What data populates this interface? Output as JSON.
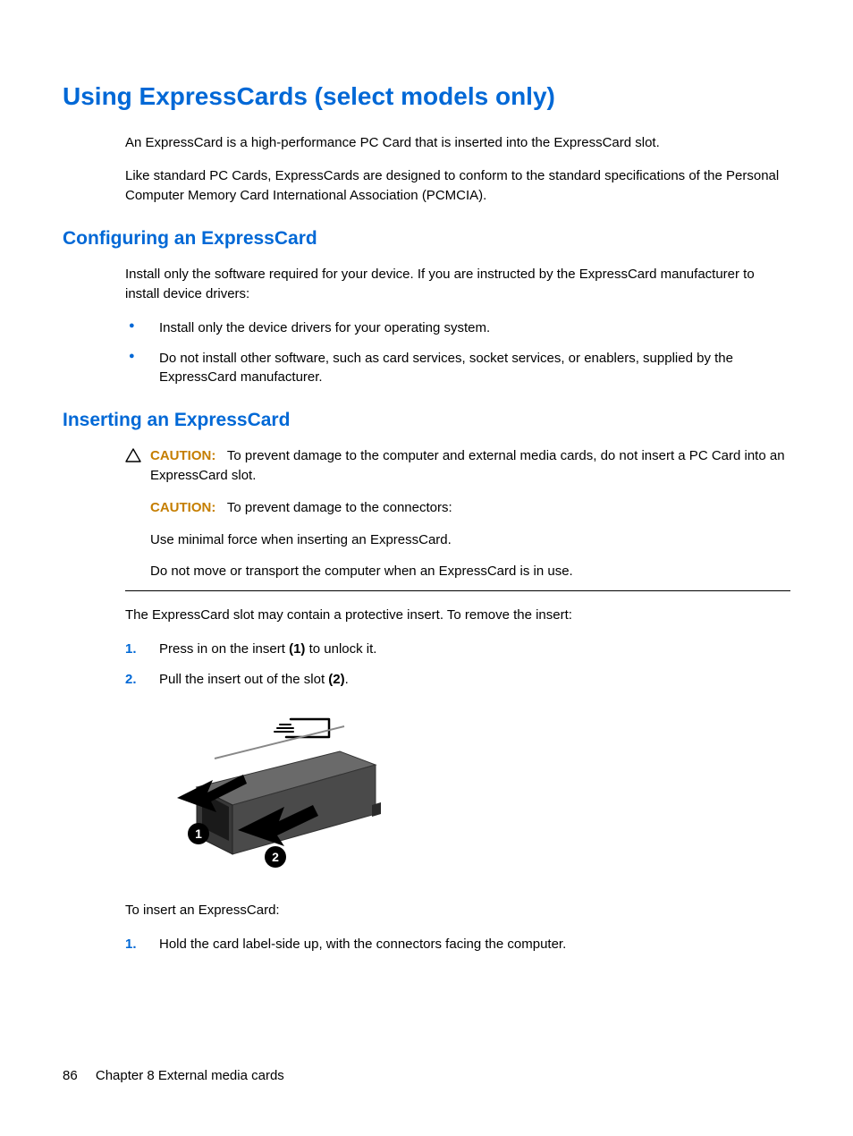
{
  "title": "Using ExpressCards (select models only)",
  "intro": {
    "p1": "An ExpressCard is a high-performance PC Card that is inserted into the ExpressCard slot.",
    "p2": "Like standard PC Cards, ExpressCards are designed to conform to the standard specifications of the Personal Computer Memory Card International Association (PCMCIA)."
  },
  "section1": {
    "heading": "Configuring an ExpressCard",
    "p1": "Install only the software required for your device. If you are instructed by the ExpressCard manufacturer to install device drivers:",
    "bullets": [
      "Install only the device drivers for your operating system.",
      "Do not install other software, such as card services, socket services, or enablers, supplied by the ExpressCard manufacturer."
    ]
  },
  "section2": {
    "heading": "Inserting an ExpressCard",
    "caution": {
      "label": "CAUTION:",
      "c1_text": "To prevent damage to the computer and external media cards, do not insert a PC Card into an ExpressCard slot.",
      "c2_text": "To prevent damage to the connectors:",
      "c3": "Use minimal force when inserting an ExpressCard.",
      "c4": "Do not move or transport the computer when an ExpressCard is in use."
    },
    "p_after_caution": "The ExpressCard slot may contain a protective insert. To remove the insert:",
    "steps_remove": [
      {
        "num": "1.",
        "pre": "Press in on the insert ",
        "bold": "(1)",
        "post": " to unlock it."
      },
      {
        "num": "2.",
        "pre": "Pull the insert out of the slot ",
        "bold": "(2)",
        "post": "."
      }
    ],
    "p_insert_intro": "To insert an ExpressCard:",
    "steps_insert": [
      {
        "num": "1.",
        "text": "Hold the card label-side up, with the connectors facing the computer."
      }
    ]
  },
  "footer": {
    "page_number": "86",
    "chapter": "Chapter 8   External media cards"
  }
}
